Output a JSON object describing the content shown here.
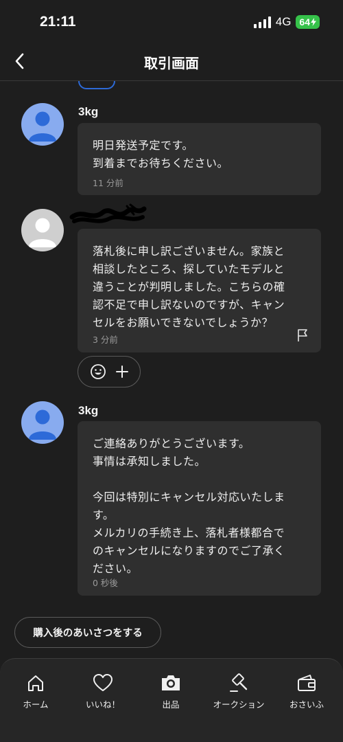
{
  "status_bar": {
    "time": "21:11",
    "network": "4G",
    "battery": "64"
  },
  "nav": {
    "title": "取引画面",
    "back_icon": "chevron-left-icon"
  },
  "messages": [
    {
      "sender": "3kg",
      "avatar_color": "#88abef",
      "text": "明日発送予定です。\n到着までお待ちください。",
      "time": "11 分前"
    },
    {
      "sender": "",
      "avatar_color": "#cfcfcf",
      "text": "落札後に申し訳ございません。家族と\n相談したところ、探していたモデルと\n違うことが判明しました。こちらの確\n認不足で申し訳ないのですが、キャン\nセルをお願いできないでしょうか？",
      "time": "3 分前",
      "flag_icon": "flag-icon"
    },
    {
      "sender": "3kg",
      "avatar_color": "#88abef",
      "text": "ご連絡ありがとうございます。\n事情は承知しました。\n\n今回は特別にキャンセル対応いたしま\nす。\nメルカリの手続き上、落札者様都合で\nのキャンセルになりますのでご了承く\nださい。",
      "time": "0 秒後"
    }
  ],
  "reactions": {
    "emoji_icon": "smile-icon",
    "add_icon": "plus-icon"
  },
  "greeting_button": "購入後のあいさつをする",
  "tab_bar": [
    {
      "label": "ホーム",
      "icon": "home-icon"
    },
    {
      "label": "いいね！",
      "icon": "heart-icon"
    },
    {
      "label": "出品",
      "icon": "camera-icon"
    },
    {
      "label": "オークション",
      "icon": "gavel-icon"
    },
    {
      "label": "おさいふ",
      "icon": "wallet-icon"
    }
  ]
}
